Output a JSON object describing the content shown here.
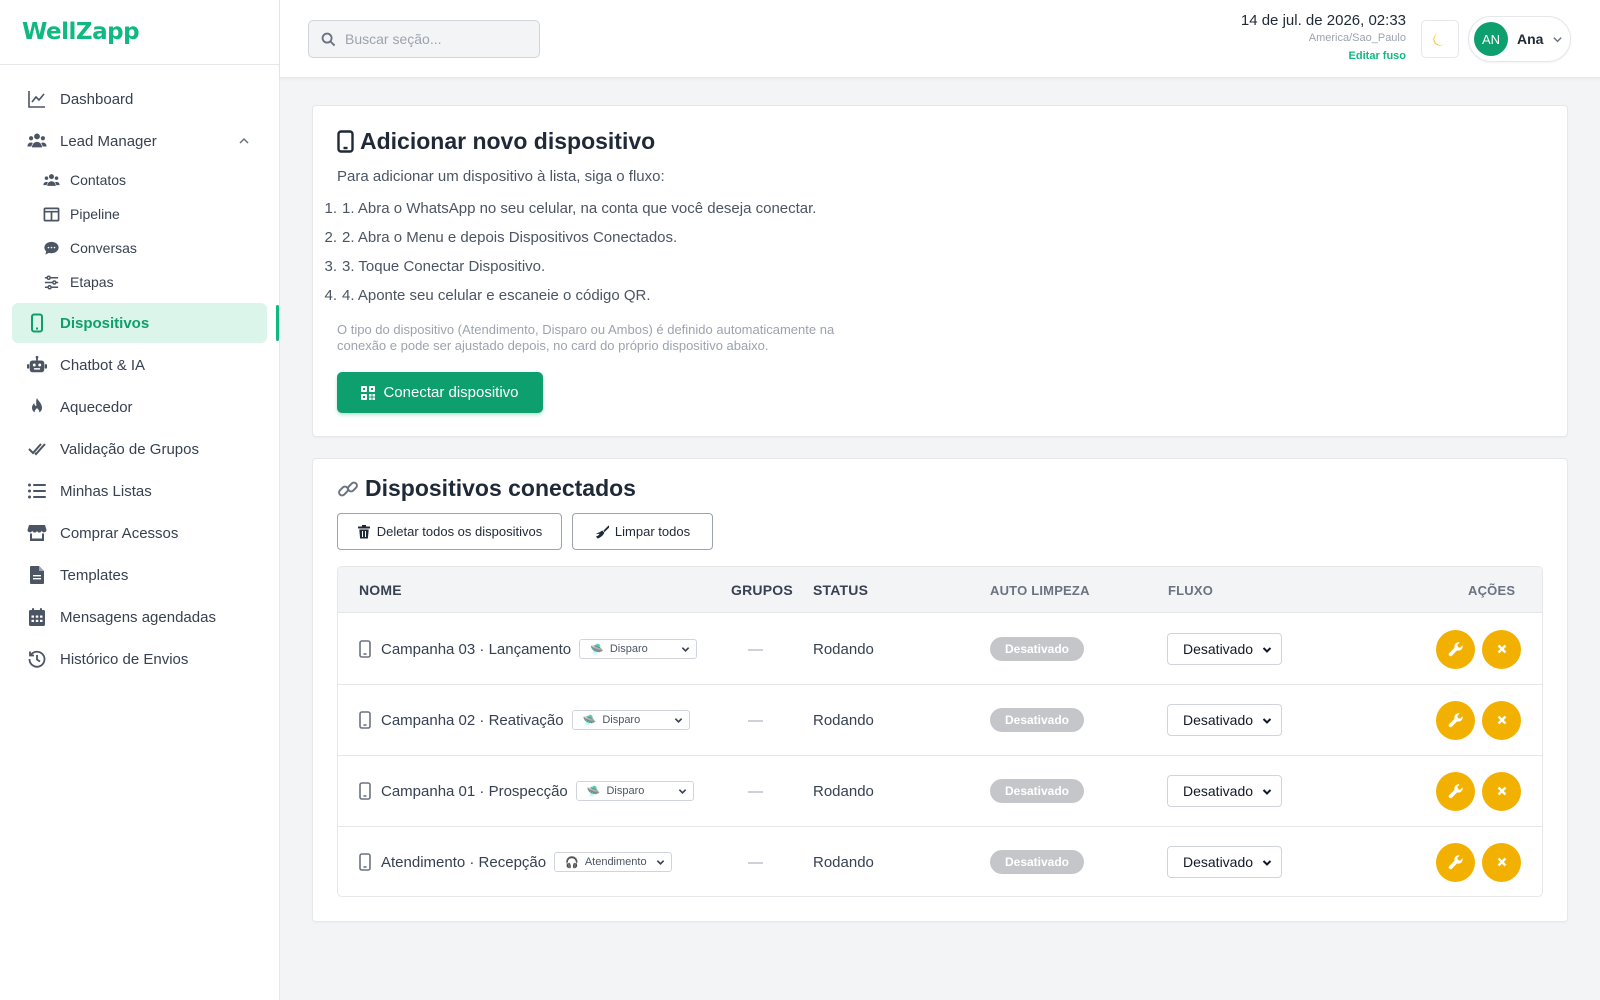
{
  "brand": {
    "name": "WellZapp",
    "accent": "#10b981"
  },
  "sidebar": {
    "items": [
      {
        "label": "Dashboard",
        "icon": "chart-line-icon"
      },
      {
        "label": "Lead Manager",
        "icon": "users-icon",
        "expanded": true,
        "children": [
          {
            "label": "Contatos",
            "icon": "users-icon"
          },
          {
            "label": "Pipeline",
            "icon": "columns-icon"
          },
          {
            "label": "Conversas",
            "icon": "chat-icon"
          },
          {
            "label": "Etapas",
            "icon": "sliders-icon"
          }
        ]
      },
      {
        "label": "Dispositivos",
        "icon": "phone-icon",
        "active": true
      },
      {
        "label": "Chatbot & IA",
        "icon": "robot-icon"
      },
      {
        "label": "Aquecedor",
        "icon": "fire-icon"
      },
      {
        "label": "Validação de Grupos",
        "icon": "double-check-icon"
      },
      {
        "label": "Minhas Listas",
        "icon": "list-icon"
      },
      {
        "label": "Comprar Acessos",
        "icon": "store-icon"
      },
      {
        "label": "Templates",
        "icon": "document-icon"
      },
      {
        "label": "Mensagens agendadas",
        "icon": "calendar-icon"
      },
      {
        "label": "Histórico de Envios",
        "icon": "history-icon"
      }
    ]
  },
  "header": {
    "search_placeholder": "Buscar seção...",
    "datetime": "14 de jul. de 2026, 02:33",
    "timezone": "America/Sao_Paulo",
    "edit_timezone": "Editar fuso",
    "theme_icon": "moon-icon",
    "user": {
      "initials": "AN",
      "name": "Ana"
    }
  },
  "add_device": {
    "title": "Adicionar novo dispositivo",
    "intro": "Para adicionar um dispositivo à lista, siga o fluxo:",
    "steps": [
      {
        "n": "1.",
        "text": "1. Abra o WhatsApp no seu celular, na conta que você deseja conectar."
      },
      {
        "n": "2.",
        "text": "2. Abra o Menu e depois Dispositivos Conectados."
      },
      {
        "n": "3.",
        "text": "3. Toque Conectar Dispositivo."
      },
      {
        "n": "4.",
        "text": "4. Aponte seu celular e escaneie o código QR."
      }
    ],
    "note_line1": "O tipo do dispositivo (Atendimento, Disparo ou Ambos) é definido automaticamente na",
    "note_line2": "conexão e pode ser ajustado depois, no card do próprio dispositivo abaixo.",
    "connect_label": "Conectar dispositivo"
  },
  "connected": {
    "title": "Dispositivos conectados",
    "delete_all_label": "Deletar todos os dispositivos",
    "clear_all_label": "Limpar todos",
    "columns": {
      "name": "NOME",
      "groups": "GRUPOS",
      "status": "STATUS",
      "auto_clean": "AUTO LIMPEZA",
      "flow": "FLUXO",
      "actions": "AÇÕES"
    },
    "rows": [
      {
        "name": "Campanha 03 · Lançamento",
        "type": "Disparo",
        "type_icon": "🛸",
        "groups": "—",
        "status": "Rodando",
        "auto_clean": "Desativado",
        "flow": "Desativado"
      },
      {
        "name": "Campanha 02 · Reativação",
        "type": "Disparo",
        "type_icon": "🛸",
        "groups": "—",
        "status": "Rodando",
        "auto_clean": "Desativado",
        "flow": "Desativado"
      },
      {
        "name": "Campanha 01 · Prospecção",
        "type": "Disparo",
        "type_icon": "🛸",
        "groups": "—",
        "status": "Rodando",
        "auto_clean": "Desativado",
        "flow": "Desativado"
      },
      {
        "name": "Atendimento · Recepção",
        "type": "Atendimento",
        "type_icon": "🎧",
        "groups": "—",
        "status": "Rodando",
        "auto_clean": "Desativado",
        "flow": "Desativado"
      }
    ],
    "colors": {
      "action": "#f2b000",
      "badge": "#c4c6ca",
      "primary": "#0e9f6e"
    }
  }
}
